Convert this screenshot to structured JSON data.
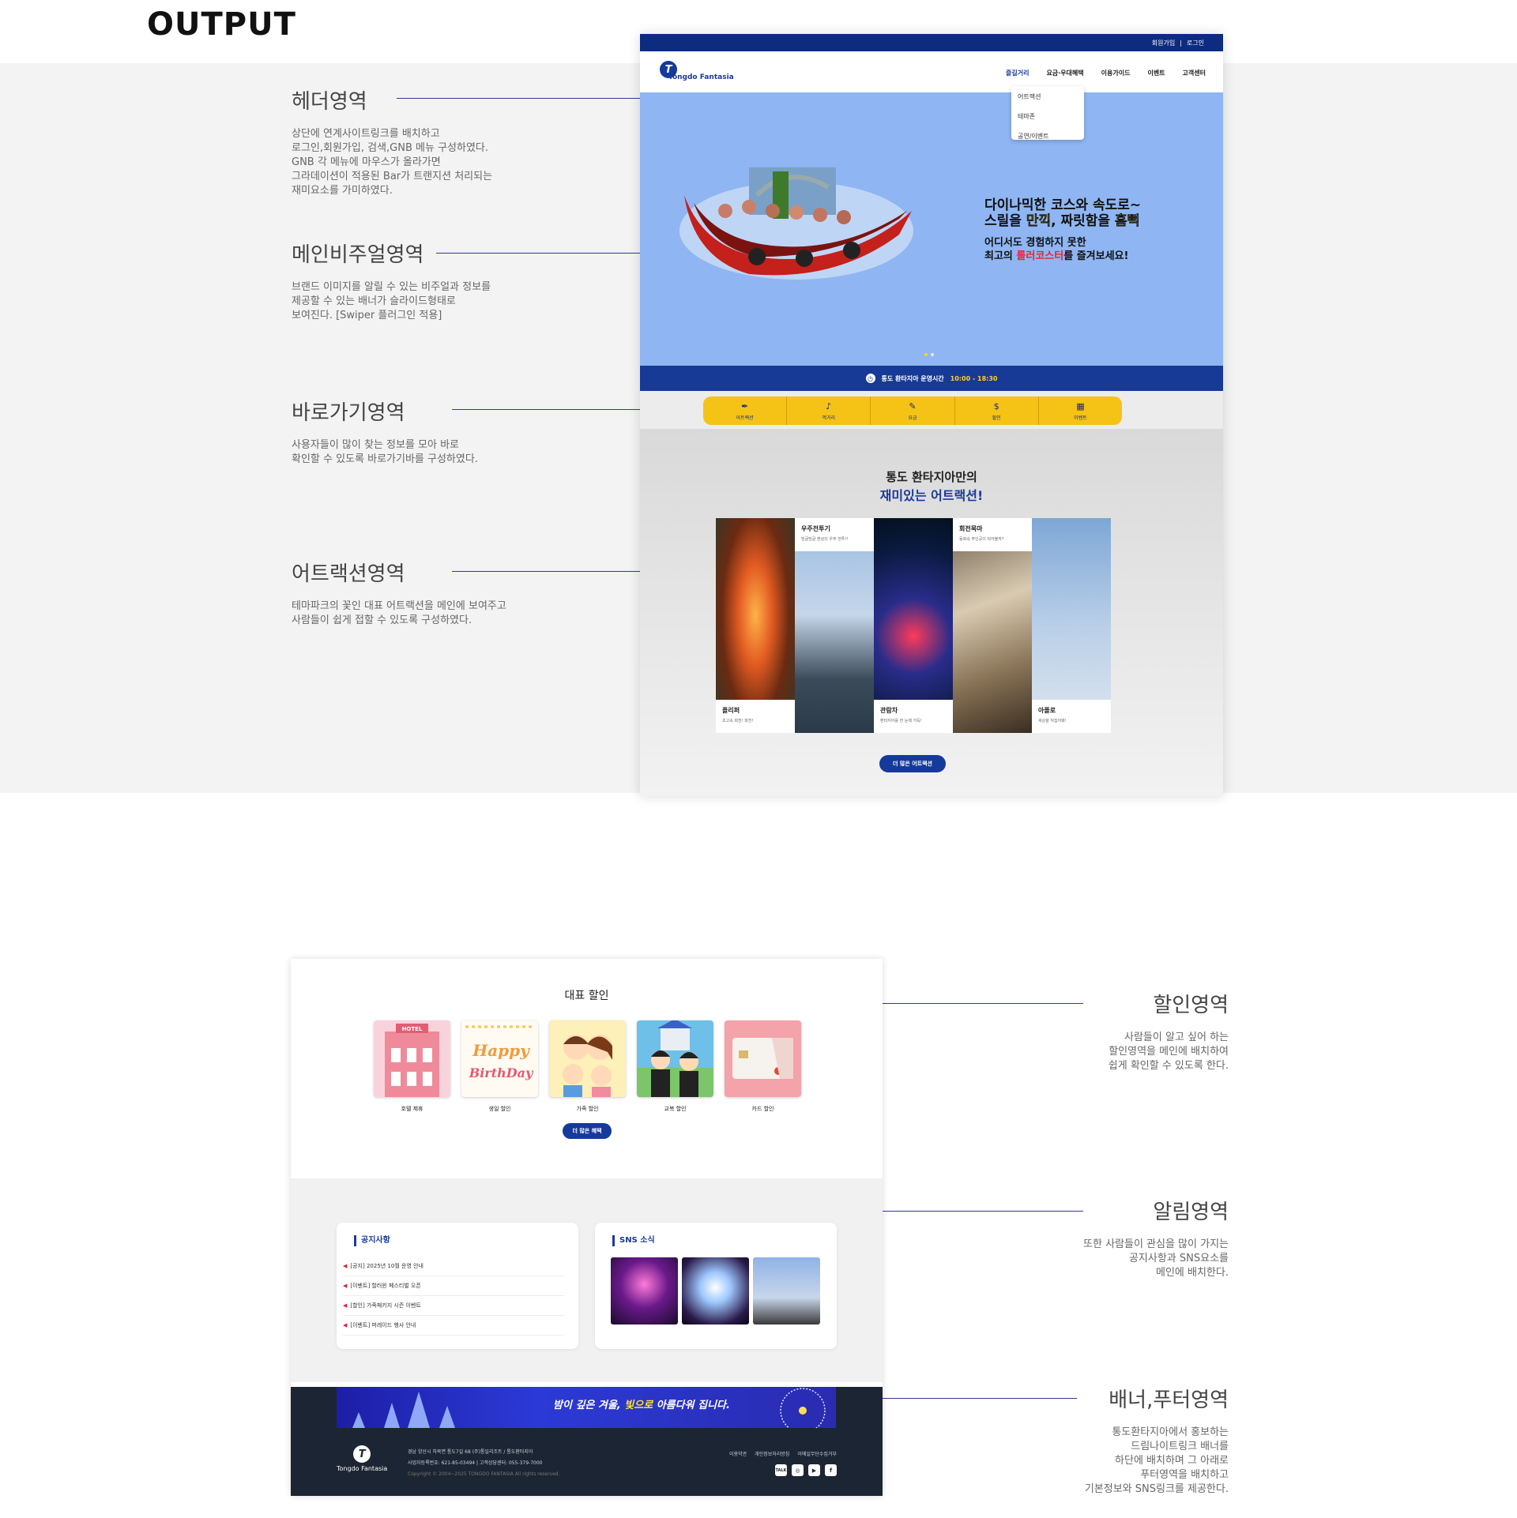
{
  "output_title": "OUTPUT",
  "annotations_left": [
    {
      "title": "헤더영역",
      "desc": "상단에 연계사이트링크를 배치하고\n 로그인,회원가입, 검색,GNB 메뉴 구성하였다.\nGNB 각 메뉴에 마우스가 올라가면\n그라데이션이 적용된 Bar가 트랜지션 처리되는\n재미요소를 가미하였다."
    },
    {
      "title": "메인비주얼영역",
      "desc": "브랜드 이미지를 알릴 수 있는 비주얼과 정보를\n제공할 수 있는 배너가 슬라이드형태로\n보여진다. [Swiper 플러그인 적용]"
    },
    {
      "title": "바로가기영역",
      "desc": "사용자들이 많이 찾는 정보를 모아 바로\n확인할 수 있도록 바로가기바를 구성하였다."
    },
    {
      "title": "어트랙션영역",
      "desc": "테마파크의 꽃인 대표 어트랙션을 메인에 보여주고\n사람들이 쉽게 접할 수 있도록 구성하였다."
    }
  ],
  "annotations_right": [
    {
      "title": "할인영역",
      "desc": "사람들이 알고 싶어 하는\n할인영역을 메인에 배치하여\n쉽게 확인할 수 있도록 한다."
    },
    {
      "title": "알림영역",
      "desc": "또한 사람들이 관심을 많이 가지는\n공지사항과 SNS요소를\n메인에 배치한다."
    },
    {
      "title": "배너,푸터영역",
      "desc": "통도환타지아에서 홍보하는\n드림나이트링크 배너를\n하단에 배치하며 그 아래로\n푸터영역을 배치하고\n기본정보와 SNS링크를 제공한다."
    }
  ],
  "site": {
    "topbar": {
      "signup": "회원가입",
      "sep": "|",
      "login": "로그인"
    },
    "logo": {
      "mark": "T",
      "text": "Tongdo Fantasia"
    },
    "gnb": [
      "즐길거리",
      "요금·우대혜택",
      "이용가이드",
      "이벤트",
      "고객센터"
    ],
    "dropdown": [
      "어트랙션",
      "테마존",
      "공연/이벤트"
    ],
    "visual": {
      "line1": "다이나믹한 코스와 속도로~",
      "line2_a": "스릴을 ",
      "line2_b": "만끽",
      "line2_c": ", 짜릿함을 ",
      "line2_d": "흠뻑",
      "line3": "어디서도 경험하지 못한",
      "line4_a": "최고의 ",
      "line4_b": "롤러코스터",
      "line4_c": "를 즐겨보세요!"
    },
    "hours": {
      "label": "통도 환타지아 운영시간",
      "time": "10:00 - 18:30"
    },
    "quick": [
      {
        "icon": "hammer-icon",
        "label": "어트랙션"
      },
      {
        "icon": "guitar-icon",
        "label": "먹거리"
      },
      {
        "icon": "ticket-icon",
        "label": "요금"
      },
      {
        "icon": "dollar-icon",
        "label": "할인"
      },
      {
        "icon": "calendar-icon",
        "label": "이벤트"
      }
    ],
    "attractions": {
      "title1": "통도 환타지아만의",
      "title2": "재미있는 어트랙션!",
      "cards": [
        {
          "name": "플리퍼",
          "desc": "초고속 회전! 회전!"
        },
        {
          "name": "우주전투기",
          "desc": "빙글빙글 환상의 우주 전투!!"
        },
        {
          "name": "관람차",
          "desc": "환타지아를 한 눈에 가득!"
        },
        {
          "name": "회전목마",
          "desc": "동화속 주인공이 되어볼까?"
        },
        {
          "name": "아폴로",
          "desc": "세상을 뒤집어봐!"
        }
      ],
      "more": "더 많은 어트랙션"
    },
    "discount": {
      "title": "대표 할인",
      "items": [
        "호텔 제휴",
        "생일 할인",
        "가족 할인",
        "교복 할인",
        "카드 할인"
      ],
      "more": "더 많은 혜택",
      "hotel_sign": "HOTEL",
      "bday_text1": "Happy",
      "bday_text2": "BirthDay"
    },
    "notice": {
      "title": "공지사항",
      "items": [
        "[공지] 2025년 10월 운영 안내",
        "[이벤트] 할러윈 페스티벌 오픈",
        "[할인] 가족패키지 시즌 이벤트",
        "[이벤트] 퍼레이드 행사 안내"
      ]
    },
    "sns": {
      "title": "SNS 소식"
    },
    "banner": {
      "text_a": "밤이 깊은 겨울, ",
      "text_b": "빛으로",
      "text_c": " 아름다워 집니다."
    },
    "footer": {
      "logo_mark": "T",
      "logo_text": "Tongdo Fantasia",
      "address": "경남 양산시 하북면 통도7길 68 (주)통일리조트 / 통도환타지아",
      "biz": "사업자등록번호: 621-85-03494 | 고객상담센터: 055-379-7000",
      "copyright": "Copyright © 2004~2025 TONGDO FANTASIA All rights reserved.",
      "links": [
        "이용약관",
        "개인정보처리방침",
        "이메일무단수집거부"
      ],
      "sns": [
        {
          "icon": "talk-icon",
          "label": "TALK"
        },
        {
          "icon": "instagram-icon",
          "label": "◎"
        },
        {
          "icon": "youtube-icon",
          "label": "▶"
        },
        {
          "icon": "facebook-icon",
          "label": "f"
        }
      ]
    }
  },
  "colors": {
    "navy": "#163a96",
    "yellow": "#f5c316",
    "sky": "#8fb6f2",
    "footer": "#1c2533"
  }
}
